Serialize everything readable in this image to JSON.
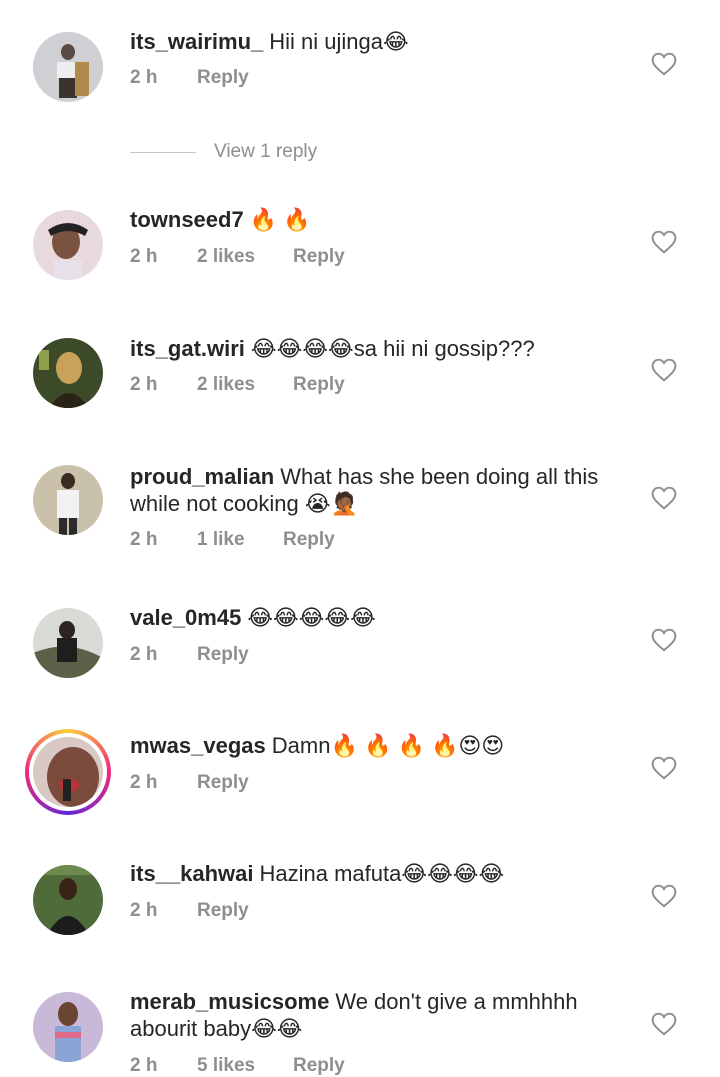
{
  "comments": [
    {
      "username": "its_wairimu_",
      "text": "Hii ni ujinga😂",
      "time": "2 h",
      "likes": "",
      "reply": "Reply"
    },
    {
      "username": "townseed7",
      "text": "🔥 🔥",
      "time": "2 h",
      "likes": "2 likes",
      "reply": "Reply"
    },
    {
      "username": "its_gat.wiri",
      "text": "😂😂😂😂sa hii ni gossip???",
      "time": "2 h",
      "likes": "2 likes",
      "reply": "Reply"
    },
    {
      "username": "proud_malian",
      "text": "What has she been doing all this while not cooking 😭🤦🏾",
      "time": "2 h",
      "likes": "1 like",
      "reply": "Reply"
    },
    {
      "username": "vale_0m45",
      "text": "😂😂😂😂😂",
      "time": "2 h",
      "likes": "",
      "reply": "Reply"
    },
    {
      "username": "mwas_vegas",
      "text": "Damn🔥 🔥 🔥 🔥😍😍",
      "time": "2 h",
      "likes": "",
      "reply": "Reply"
    },
    {
      "username": "its__kahwai",
      "text": "Hazina mafuta😂😂😂😂",
      "time": "2 h",
      "likes": "",
      "reply": "Reply"
    },
    {
      "username": "merab_musicsome",
      "text": "We don't give a mmhhhh abourit baby😂😂",
      "time": "2 h",
      "likes": "5 likes",
      "reply": "Reply"
    }
  ],
  "view_replies": "View 1 reply",
  "icons": {
    "like": "heart-outline-icon"
  }
}
